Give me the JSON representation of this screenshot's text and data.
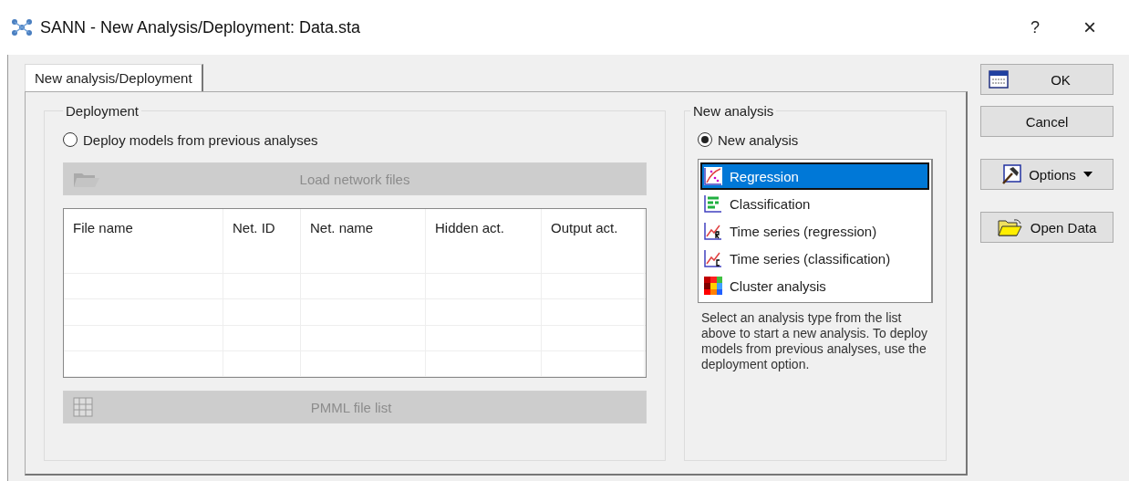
{
  "window": {
    "title": "SANN - New Analysis/Deployment: Data.sta",
    "help": "?",
    "close": "×"
  },
  "tabs": [
    {
      "label": "New analysis/Deployment",
      "selected": true
    }
  ],
  "deployment": {
    "title": "Deployment",
    "radio": {
      "label": "Deploy models from previous analyses",
      "selected": false
    },
    "load_button": {
      "label": "Load network files",
      "disabled": true
    },
    "table": {
      "columns": [
        "File name",
        "Net. ID",
        "Net. name",
        "Hidden act.",
        "Output act."
      ]
    },
    "pmml_button": {
      "label": "PMML file list",
      "disabled": true
    }
  },
  "new_analysis": {
    "title": "New analysis",
    "radio": {
      "label": "New analysis",
      "selected": true
    },
    "items": [
      {
        "label": "Regression",
        "selected": true
      },
      {
        "label": "Classification",
        "selected": false
      },
      {
        "label": "Time series (regression)",
        "selected": false
      },
      {
        "label": "Time series (classification)",
        "selected": false
      },
      {
        "label": "Cluster analysis",
        "selected": false
      }
    ],
    "hint": "Select an analysis type from the list above to start a new analysis. To deploy models from previous analyses, use the deployment option."
  },
  "buttons": [
    {
      "label": "OK",
      "kind": "ok"
    },
    {
      "label": "Cancel",
      "kind": "plain"
    },
    {
      "label": "Options",
      "kind": "menu"
    },
    {
      "label": "Open Data",
      "kind": "open"
    }
  ]
}
